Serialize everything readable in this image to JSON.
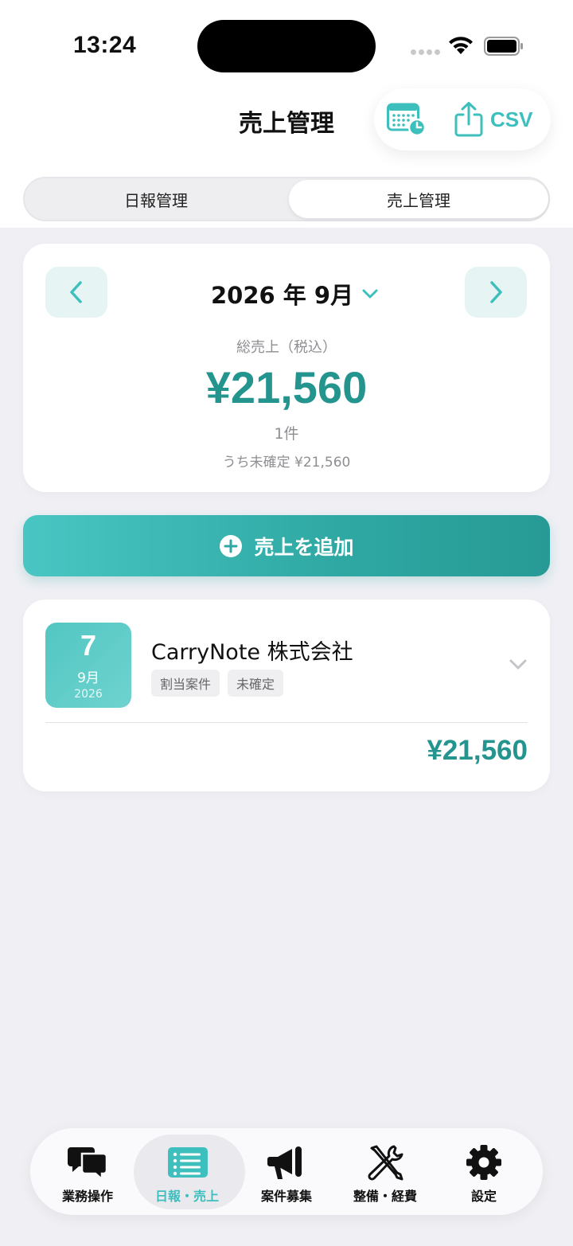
{
  "status_bar": {
    "time": "13:24"
  },
  "header": {
    "title": "売上管理",
    "csv_label": "CSV"
  },
  "segments": [
    {
      "label": "日報管理",
      "selected": false
    },
    {
      "label": "売上管理",
      "selected": true
    }
  ],
  "summary": {
    "month": "2026 年 9月",
    "total_label": "総売上（税込）",
    "total_value": "¥21,560",
    "count": "1件",
    "pending": "うち未確定 ¥21,560"
  },
  "add_button": {
    "label": "売上を追加"
  },
  "entries": [
    {
      "day": "7",
      "month": "9月",
      "year": "2026",
      "company": "CarryNote 株式会社",
      "tags": [
        "割当案件",
        "未確定"
      ],
      "amount": "¥21,560"
    }
  ],
  "tabbar": [
    {
      "label": "業務操作",
      "icon": "chat-bubbles-icon",
      "active": false
    },
    {
      "label": "日報・売上",
      "icon": "list-icon",
      "active": true
    },
    {
      "label": "案件募集",
      "icon": "megaphone-icon",
      "active": false
    },
    {
      "label": "整備・経費",
      "icon": "tools-icon",
      "active": false
    },
    {
      "label": "設定",
      "icon": "gear-icon",
      "active": false
    }
  ],
  "colors": {
    "accent": "#3DBFBE",
    "accent_dark": "#24948F",
    "background": "#EFEFF4"
  }
}
